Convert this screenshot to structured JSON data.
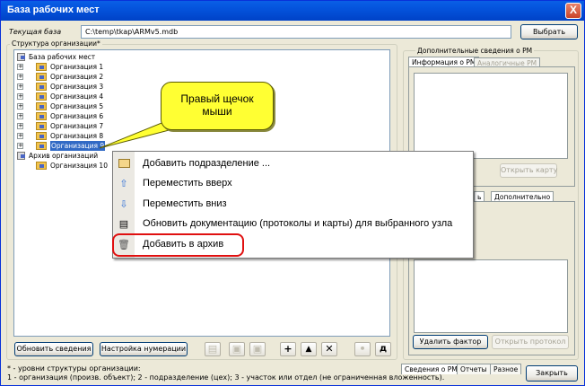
{
  "window": {
    "title": "База рабочих мест",
    "close_symbol": "X"
  },
  "current_db": {
    "label": "Текущая база",
    "path": "C:\\temp\\tkap\\ARMv5.mdb",
    "choose_button": "Выбрать"
  },
  "structure": {
    "group_title": "Структура организации*",
    "root": "База рабочих мест",
    "orgs": [
      "Организация 1",
      "Организация 2",
      "Организация 3",
      "Организация 4",
      "Организация 5",
      "Организация 6",
      "Организация 7",
      "Организация 8",
      "Организация 9"
    ],
    "selected_index": 8,
    "archive_root": "Архив организаций",
    "archive_items": [
      "Организация 10"
    ],
    "expander_symbol": "+"
  },
  "right_panel": {
    "group_title": "Дополнительные сведения о РМ",
    "tab_info": "Информация о РМ",
    "tab_analog": "Аналогичные РМ",
    "open_card_button": "Открыть карту",
    "tab_partial_1": "ь",
    "tab_extra": "Дополнительно",
    "delete_factor_button": "Удалить фактор",
    "open_protocol_button": "Открыть протокол"
  },
  "bottom_toolbar": {
    "refresh_button": "Обновить сведения",
    "numbering_button": "Настройка нумерации",
    "add_symbol": "+",
    "up_symbol": "▲",
    "delete_symbol": "✕",
    "dot_symbol": "•",
    "d_symbol": "д"
  },
  "bottom_tabs": {
    "tab1": "Сведения о РМ",
    "tab2": "Отчеты",
    "tab3": "Разное"
  },
  "close_button": "Закрыть",
  "footnote": {
    "line1": "* - уровни структуры организации:",
    "line2": "1 - организация (произв. объект); 2 - подразделение (цех); 3 - участок или отдел (не ограниченная вложенность)."
  },
  "callout": {
    "line1": "Правый щечок",
    "line2": "мыши"
  },
  "context_menu": {
    "items": [
      {
        "label": "Добавить подразделение ...",
        "icon": "folder-icon"
      },
      {
        "label": "Переместить вверх",
        "icon": "arrow-up-icon"
      },
      {
        "label": "Переместить вниз",
        "icon": "arrow-down-icon"
      },
      {
        "label": "Обновить документацию (протоколы и карты) для выбранного узла",
        "icon": "document-list-icon"
      },
      {
        "label": "Добавить в архив",
        "icon": "trash-icon"
      }
    ],
    "highlighted_index": 4,
    "highlight_color": "#e01010"
  }
}
